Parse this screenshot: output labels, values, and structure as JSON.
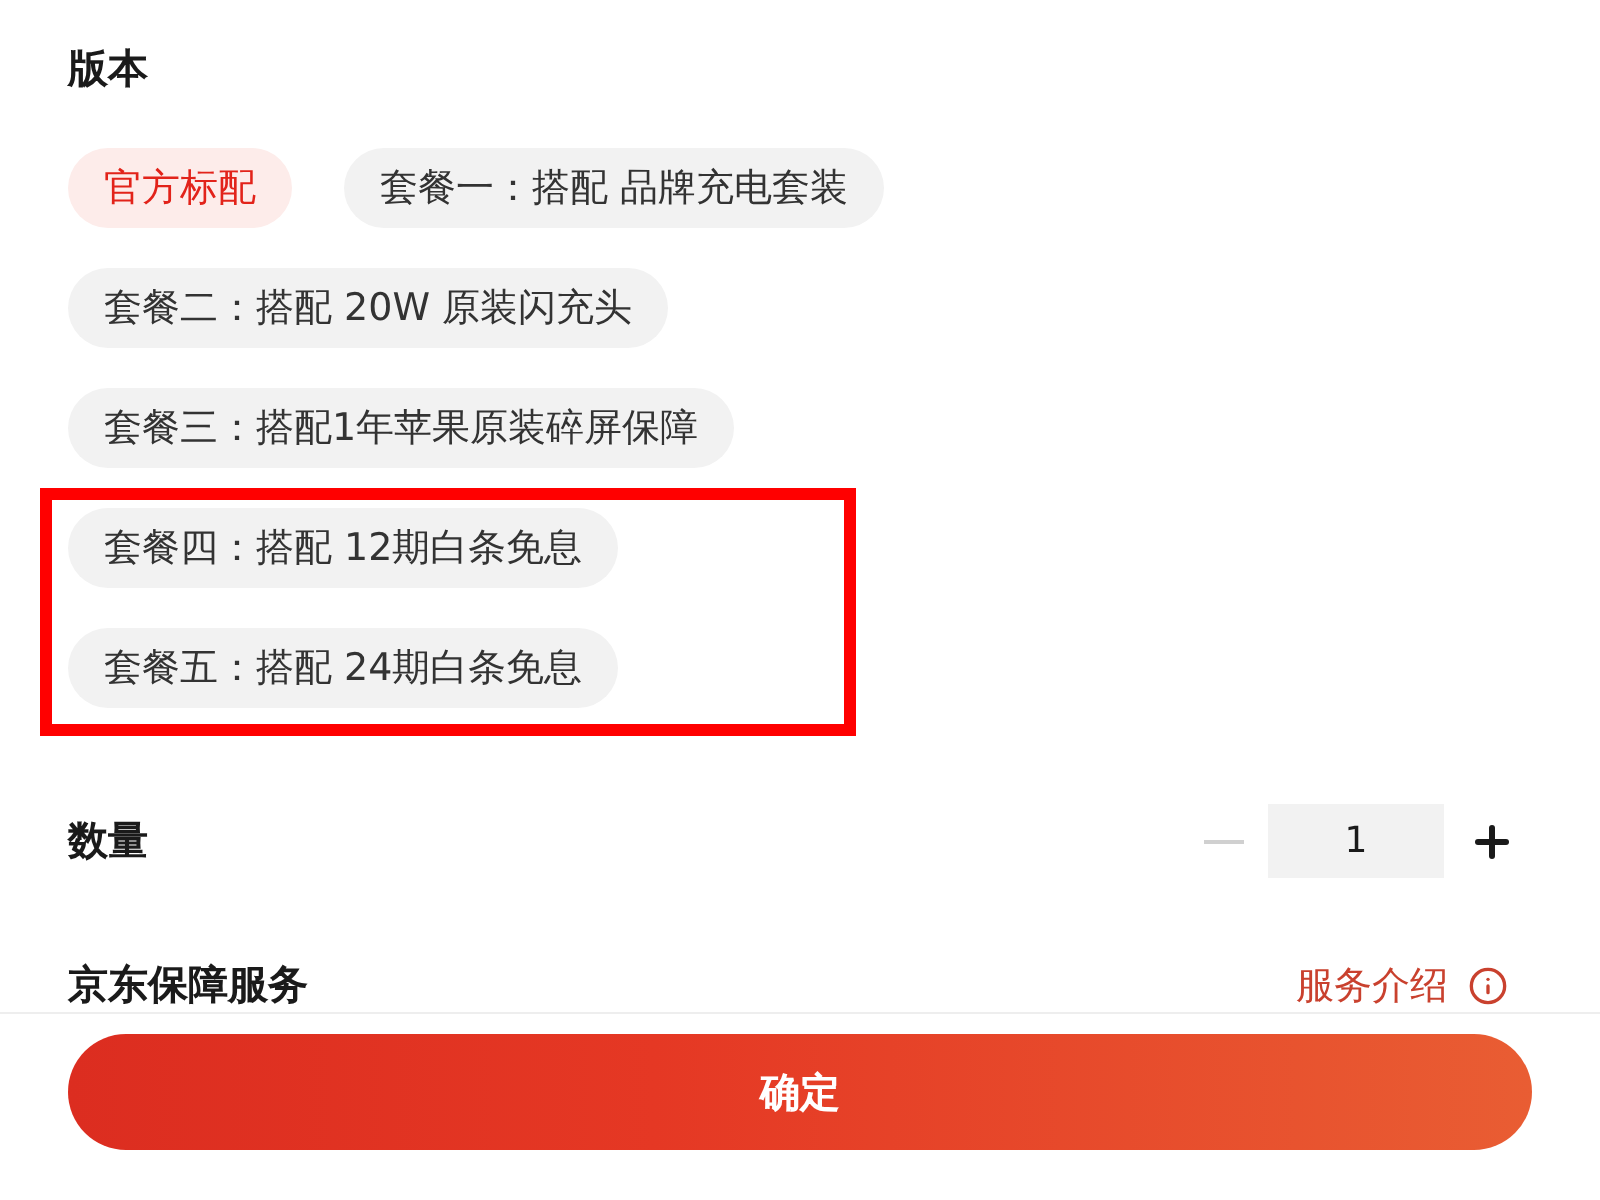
{
  "version_section": {
    "title": "版本",
    "options": [
      {
        "label": "官方标配",
        "selected": true,
        "highlighted": false
      },
      {
        "label": "套餐一：搭配 品牌充电套装",
        "selected": false,
        "highlighted": false
      },
      {
        "label": "套餐二：搭配 20W 原装闪充头",
        "selected": false,
        "highlighted": false
      },
      {
        "label": "套餐三：搭配1年苹果原装碎屏保障",
        "selected": false,
        "highlighted": false
      },
      {
        "label": "套餐四：搭配 12期白条免息",
        "selected": false,
        "highlighted": true
      },
      {
        "label": "套餐五：搭配 24期白条免息",
        "selected": false,
        "highlighted": true
      }
    ]
  },
  "quantity": {
    "label": "数量",
    "value": "1",
    "minus_disabled": true
  },
  "service": {
    "title": "京东保障服务",
    "link": "服务介绍"
  },
  "confirm_button": "确定"
}
